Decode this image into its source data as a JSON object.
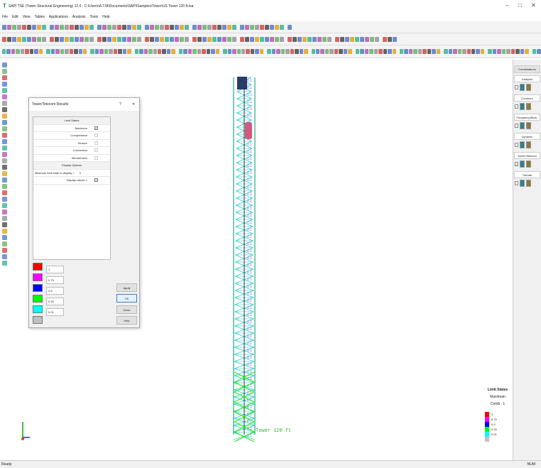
{
  "app": {
    "title": "SAPI TSE (Tower Structural Engineering) 12.0 - C:\\Users\\A.T.M\\Documents\\SAPI\\Samples\\Tower\\US Tower 120 ft.tsa",
    "window_controls": [
      "–",
      "□",
      "✕"
    ]
  },
  "menu": [
    "File",
    "Edit",
    "View",
    "Tables",
    "Applications",
    "Analysis",
    "Tools",
    "Help"
  ],
  "dialog": {
    "title": "Tower/Telecom Results",
    "help": "?",
    "close": "✕",
    "rows": [
      {
        "label": "Limit States",
        "header": true
      },
      {
        "label": "Maximum",
        "checked": true,
        "enabled": true
      },
      {
        "label": "Compression",
        "checked": true,
        "enabled": false
      },
      {
        "label": "Tension",
        "checked": true,
        "enabled": false
      },
      {
        "label": "Connection",
        "checked": true,
        "enabled": false
      },
      {
        "label": "Slenderness",
        "checked": true,
        "enabled": false
      },
      {
        "label": "Display Options",
        "header": true
      },
      {
        "label": "Minimum limit state to display =",
        "value": "0"
      },
      {
        "label": "Display values =",
        "checked": true,
        "enabled": true
      }
    ],
    "colors": [
      {
        "color": "#ff0000",
        "value": "1"
      },
      {
        "color": "#ff00ff",
        "value": "0.75"
      },
      {
        "color": "#0000ff",
        "value": "0.5"
      },
      {
        "color": "#00ff00",
        "value": "0.25"
      },
      {
        "color": "#00ffff",
        "value": "0.01"
      },
      {
        "color": "#c0c0c0",
        "value": ""
      }
    ],
    "buttons": {
      "apply": "Apply",
      "ok": "OK",
      "close": "Close",
      "help": "Help"
    }
  },
  "right_panel": {
    "combinations": "Combinations",
    "sections": [
      {
        "label": "Analysis",
        "checked": false
      },
      {
        "label": "Contours",
        "checked": false,
        "button": true
      },
      {
        "label": "Frequency/Buck.",
        "checked": false
      },
      {
        "label": "Dynamic",
        "checked": false
      },
      {
        "label": "Tower/Telecom",
        "checked": true
      },
      {
        "label": "Tubular",
        "checked": false
      }
    ]
  },
  "viewport": {
    "tower_label": "Tower 120 ft"
  },
  "legend": {
    "title": "Limit States",
    "subtitle": "Maximum",
    "comb": "Comb.: 1",
    "items": [
      {
        "color": "#ff0000",
        "label": "1"
      },
      {
        "color": "#ff00ff",
        "label": "0.75"
      },
      {
        "color": "#0000ff",
        "label": "0.5"
      },
      {
        "color": "#00ff00",
        "label": "0.25"
      },
      {
        "color": "#00ffff",
        "label": "0.01"
      },
      {
        "color": "#c0c0c0",
        "label": ""
      }
    ]
  },
  "status": {
    "left": "Ready",
    "right": "NUM"
  }
}
